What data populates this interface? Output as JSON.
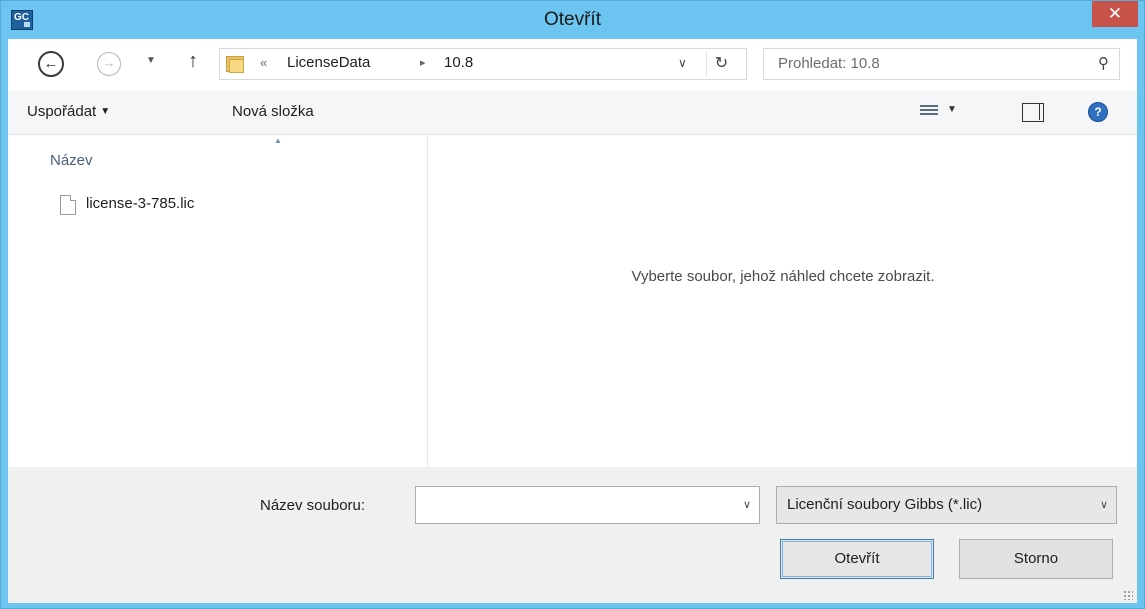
{
  "window": {
    "title": "Otevřít",
    "app_icon_text": "GC",
    "close_symbol": "✕"
  },
  "nav": {
    "back_symbol": "←",
    "forward_symbol": "→",
    "recent_symbol": "▼",
    "up_symbol": "↑",
    "breadcrumb": {
      "prefix": "«",
      "items": [
        "LicenseData",
        "10.8"
      ],
      "separator": "▸"
    },
    "address_dropdown_symbol": "∨",
    "refresh_symbol": "↻"
  },
  "search": {
    "placeholder": "Prohledat: 10.8",
    "icon": "⚲"
  },
  "toolbar": {
    "organize_label": "Uspořádat",
    "new_folder_label": "Nová složka",
    "caret": "▼",
    "help_symbol": "?"
  },
  "files": {
    "column_header": "Název",
    "sort_indicator": "▲",
    "items": [
      {
        "name": "license-3-785.lic"
      }
    ]
  },
  "scrollbar": {
    "left": "<",
    "right": ">"
  },
  "preview": {
    "message": "Vyberte soubor, jehož náhled chcete zobrazit."
  },
  "footer": {
    "filename_label": "Název souboru:",
    "filename_value": "",
    "dropdown_symbol": "∨",
    "filter_value": "Licenční soubory Gibbs (*.lic)",
    "open_label": "Otevřít",
    "cancel_label": "Storno"
  },
  "colors": {
    "title_bar": "#6cc5f0",
    "close_button": "#c7524a",
    "toolbar": "#f5f6f7",
    "footer": "#f0f0f0"
  }
}
